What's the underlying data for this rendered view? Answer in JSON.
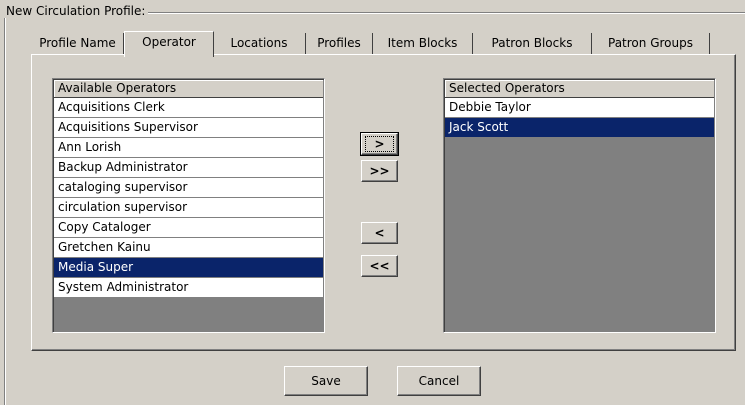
{
  "group_title": "New Circulation Profile:",
  "tabs": [
    {
      "label": "Profile Name"
    },
    {
      "label": "Operator"
    },
    {
      "label": "Locations"
    },
    {
      "label": "Profiles"
    },
    {
      "label": "Item Blocks"
    },
    {
      "label": "Patron Blocks"
    },
    {
      "label": "Patron Groups"
    }
  ],
  "active_tab": "Operator",
  "available": {
    "header": "Available Operators",
    "items": [
      "Acquisitions Clerk",
      "Acquisitions Supervisor",
      "Ann Lorish",
      "Backup Administrator",
      "cataloging supervisor",
      "circulation supervisor",
      "Copy Cataloger",
      "Gretchen Kainu",
      "Media Super",
      "System Administrator"
    ],
    "selected": "Media Super"
  },
  "selected_ops": {
    "header": "Selected Operators",
    "items": [
      "Debbie Taylor",
      "Jack Scott"
    ],
    "selected": "Jack Scott"
  },
  "move_buttons": {
    "add_one": ">",
    "add_all": ">>",
    "remove_one": "<",
    "remove_all": "<<"
  },
  "footer": {
    "save": "Save",
    "cancel": "Cancel"
  }
}
